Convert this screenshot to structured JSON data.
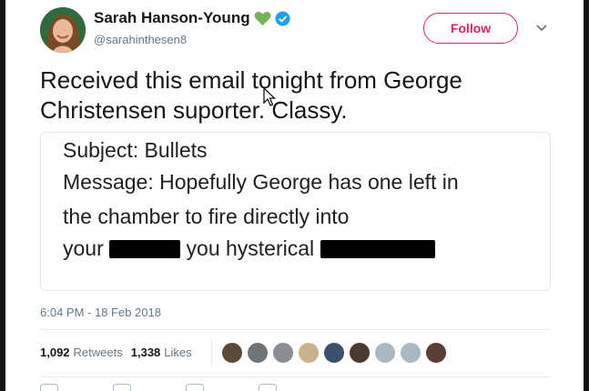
{
  "author": {
    "display_name": "Sarah Hanson-Young",
    "handle": "@sarahinthesen8",
    "heart_color": "#77b255",
    "verified_color": "#1da1f2"
  },
  "header": {
    "follow_label": "Follow",
    "menu_icon": "chevron-down-icon"
  },
  "tweet": {
    "text_line1": "Received this email tonight from George",
    "text_line2": "Christensen suporter. Classy."
  },
  "media": {
    "subject": "Subject: Bullets",
    "message_line1": "Message: Hopefully George has one left in",
    "message_line2": "the chamber to fire directly into",
    "message_line3_part1": "your",
    "message_line3_part2": "you hysterical"
  },
  "timestamp": "6:04 PM - 18 Feb 2018",
  "stats": {
    "retweets_count": "1,092",
    "retweets_label": "Retweets",
    "likes_count": "1,338",
    "likes_label": "Likes"
  },
  "liker_avatars": [
    {
      "color": "#5a4a3a"
    },
    {
      "color": "#6f7478"
    },
    {
      "color": "#8a8e92"
    },
    {
      "color": "#c9b28d"
    },
    {
      "color": "#3b4f6e"
    },
    {
      "color": "#4a3a30"
    },
    {
      "color": "#aab8c2"
    },
    {
      "color": "#aab8c2"
    },
    {
      "color": "#5b3f34"
    }
  ],
  "colors": {
    "follow": "#e0245e",
    "secondary_text": "#657786",
    "primary_text": "#14171a"
  }
}
